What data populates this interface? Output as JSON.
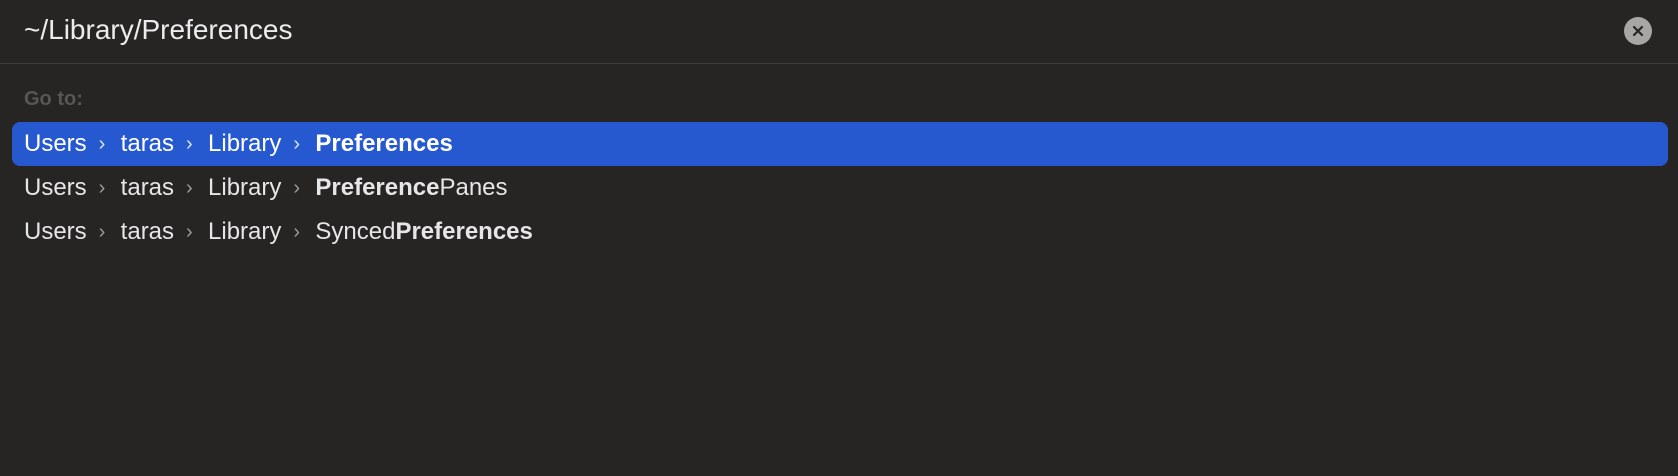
{
  "search": {
    "value": "~/Library/Preferences",
    "clear_icon": "close-icon"
  },
  "goto_label": "Go to:",
  "separator_icon": "chevron-right-icon",
  "colors": {
    "background": "#262524",
    "selection": "#2659cf",
    "muted_label": "#575655"
  },
  "results": [
    {
      "selected": true,
      "path": [
        "Users",
        "taras",
        "Library"
      ],
      "leaf": {
        "pre": "",
        "bold": "Preferences",
        "post": ""
      }
    },
    {
      "selected": false,
      "path": [
        "Users",
        "taras",
        "Library"
      ],
      "leaf": {
        "pre": "",
        "bold": "Preference",
        "post": "Panes"
      }
    },
    {
      "selected": false,
      "path": [
        "Users",
        "taras",
        "Library"
      ],
      "leaf": {
        "pre": "Synced",
        "bold": "Preferences",
        "post": ""
      }
    }
  ]
}
